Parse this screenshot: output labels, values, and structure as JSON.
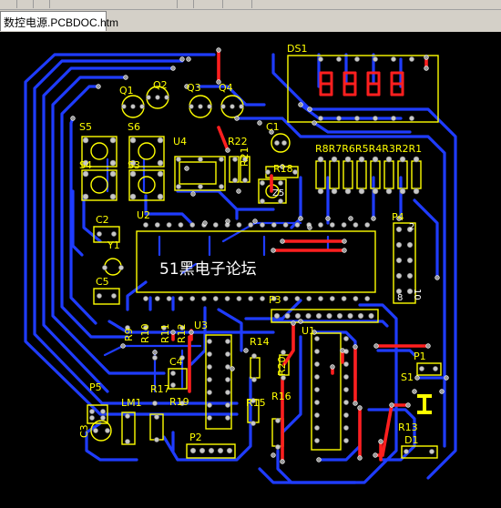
{
  "document_tab": {
    "label": "数控电源.PCBDOC.htm"
  },
  "colors": {
    "workspace": "#d4d0c8",
    "board": "#000000",
    "bottom_layer": "#1f3cff",
    "top_layer": "#ff1f1f",
    "silkscreen": "#ffff00",
    "pad": "#c8c8c8",
    "via": "#a0a0a0"
  },
  "pcb": {
    "center_label": "51黑电子论坛",
    "designators": {
      "DS1": "DS1",
      "Q1": "Q1",
      "Q2": "Q2",
      "Q3": "Q3",
      "Q4": "Q4",
      "S5": "S5",
      "S6": "S6",
      "S4": "S4",
      "S3": "S3",
      "U4": "U4",
      "R22": "R22",
      "R21": "R21",
      "C1": "C1",
      "R18": "R18",
      "RR": "R8R7R6R5R4R3R2R1",
      "C2": "C2",
      "Y1": "Y1",
      "U2": "U2",
      "P4": "P4",
      "C5": "C5",
      "P3": "P3",
      "R9": "R9",
      "R10": "R10",
      "R11": "R11",
      "R12": "R12",
      "U3": "U3",
      "U1": "U1",
      "R14": "R14",
      "R20": "R20",
      "C4": "C4",
      "P1": "P1",
      "S1": "S1",
      "P5": "P5",
      "LM1": "LM1",
      "R17": "R17",
      "R19": "R19",
      "R16": "R16",
      "R15": "R15",
      "C3": "C3",
      "R13": "R13",
      "D1": "D1",
      "P2": "P2"
    },
    "pin_labels": {
      "p4_top": "2",
      "p4_bottom": "10",
      "p4_left": "8"
    }
  }
}
